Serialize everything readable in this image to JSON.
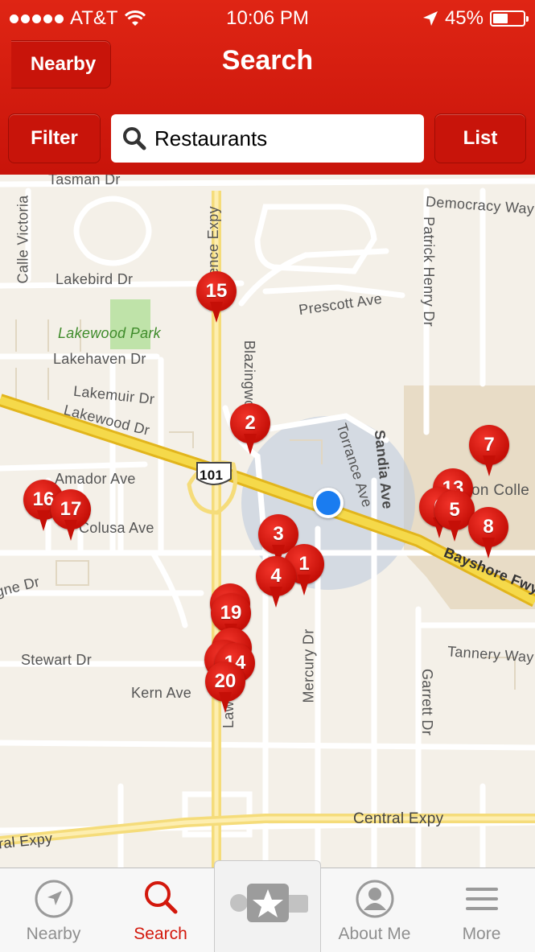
{
  "status_bar": {
    "carrier": "AT&T",
    "time": "10:06 PM",
    "battery": "45%"
  },
  "nav": {
    "back_label": "Nearby",
    "title": "Search"
  },
  "search": {
    "filter_label": "Filter",
    "query": "Restaurants",
    "list_label": "List"
  },
  "map": {
    "street_labels": [
      "Tasman Dr",
      "Calle Victoria",
      "Lakebird Dr",
      "Lakewood Park",
      "Lakehaven Dr",
      "Lakemuir Dr",
      "Lakewood Dr",
      "Amador Ave",
      "Colusa Ave",
      "gne Dr",
      "Stewart Dr",
      "Kern Ave",
      "Lawrence Expy",
      "ence Expy",
      "Blazingwood",
      "Prescott Ave",
      "Torrance Ave",
      "Sandia Ave",
      "Democracy Way",
      "Patrick Henry Dr",
      "Mercury Dr",
      "Tannery Way",
      "Garrett Dr",
      "Central Expy",
      "ral Expy",
      "Bayshore Fwy",
      "101",
      "on Colle"
    ],
    "pins": [
      "15",
      "2",
      "7",
      "13",
      "6",
      "5",
      "8",
      "16",
      "17",
      "3",
      "1",
      "4",
      "19",
      "14",
      "20"
    ]
  },
  "tabbar": {
    "tabs": [
      "Nearby",
      "Search",
      "About Me",
      "More"
    ]
  },
  "colors": {
    "brand": "#d3180c",
    "pin": "#d3180c",
    "user_location": "#1a7cf0",
    "freeway": "#f1d33a"
  }
}
